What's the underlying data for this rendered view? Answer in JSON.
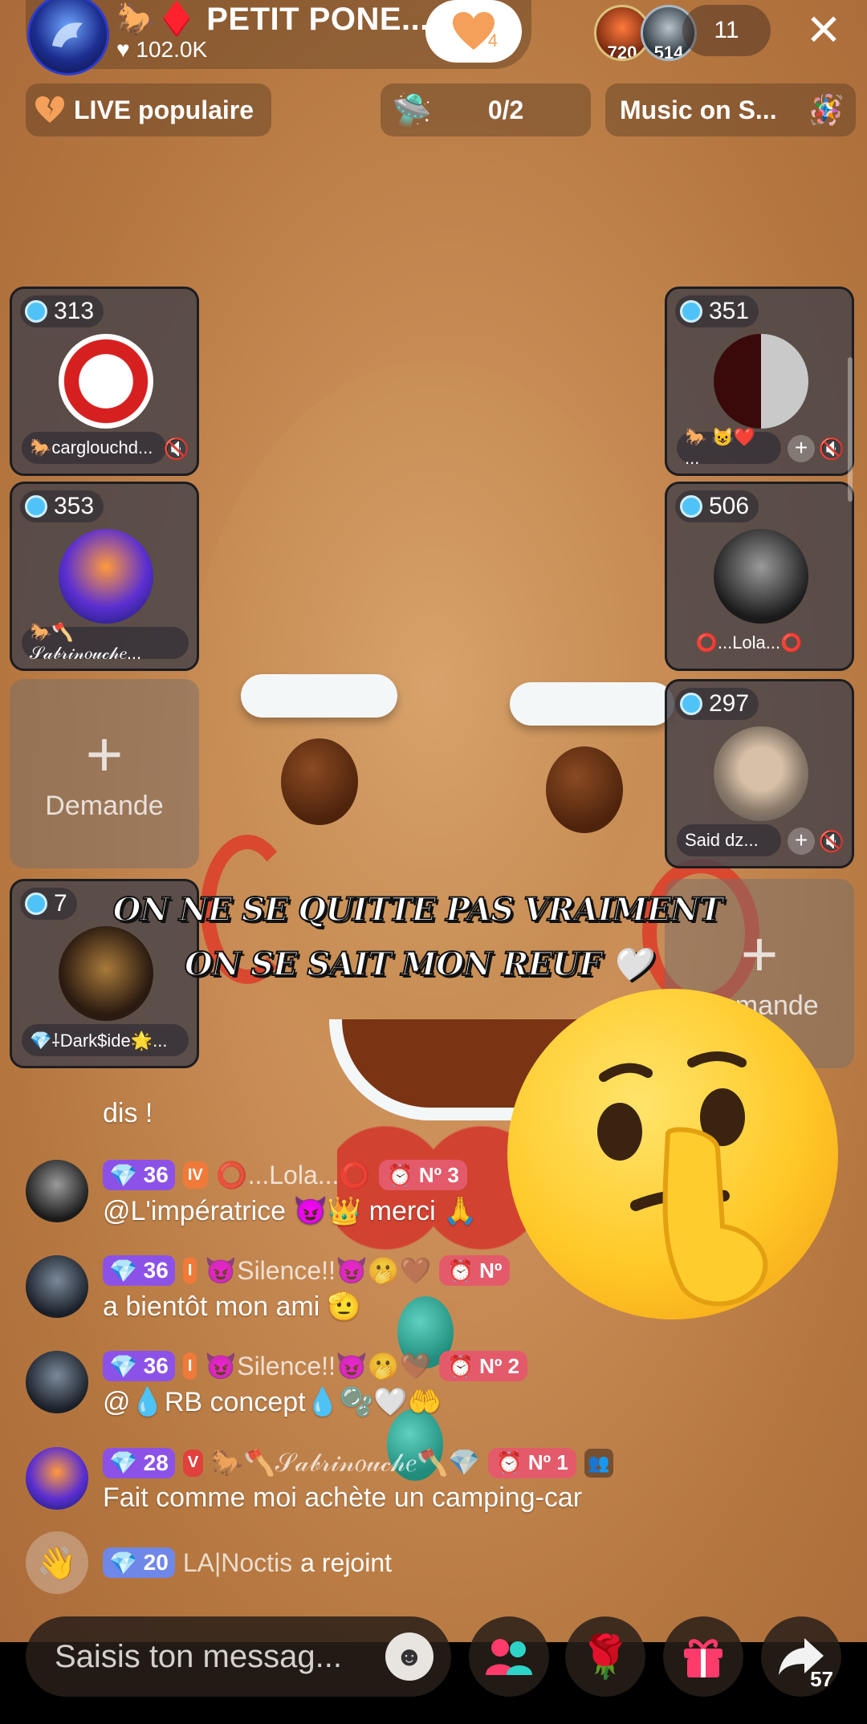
{
  "header": {
    "host_name": "🐎♦️ PETIT PONE...",
    "likes": "102.0K",
    "follow_badge": "4",
    "viewer_1_count": "720",
    "viewer_2_count": "514",
    "viewer_total": "11"
  },
  "chips": {
    "popular": "LIVE populaire",
    "progress": "0/2",
    "music": "Music on S..."
  },
  "tiles": {
    "left": [
      {
        "score": "313",
        "name": "🐎carglouchd..."
      },
      {
        "score": "353",
        "name": "🐎🪓𝒮𝒶𝒷𝓇𝒾𝓃𝑜𝓊𝒸𝒽𝑒..."
      },
      {
        "request_label": "Demande"
      },
      {
        "score": "7",
        "name": "💎⸸Dark$ide🌟..."
      }
    ],
    "right": [
      {
        "score": "351",
        "name": "🐎 😺❤️ ..."
      },
      {
        "score": "506",
        "name": "⭕...Lola...⭕"
      },
      {
        "score": "297",
        "name": "Said dz..."
      },
      {
        "request_label": "Demande"
      }
    ]
  },
  "overlay": {
    "line1": "ON NE SE QUITTE PAS VRAIMENT",
    "line2": "ON SE SAIT MON REUF 🤍"
  },
  "chat": [
    {
      "message": "dis !"
    },
    {
      "level": "36",
      "name": "⭕...Lola...⭕",
      "rank": "Nº 3",
      "message": "@L'impératrice 😈👑 merci 🙏"
    },
    {
      "level": "36",
      "name": "😈Silence!!😈🫢🤎",
      "rank": "Nº",
      "message": "a bientôt mon ami 🫡"
    },
    {
      "level": "36",
      "name": "😈Silence!!😈🫢🤎",
      "rank": "Nº 2",
      "message": "@💧RB concept💧🫧🤍🤲"
    },
    {
      "level": "28",
      "name": "🐎🪓𝒮𝒶𝒷𝓇𝒾𝓃𝑜𝓊𝒸𝒽𝑒🪓💎",
      "rank": "Nº 1",
      "message": "Fait comme moi achète un camping-car"
    },
    {
      "level": "20",
      "name": "LA|Noctis",
      "message": "a rejoint"
    }
  ],
  "bottom": {
    "placeholder": "Saisis ton messag...",
    "share_count": "57"
  },
  "colors": {
    "level_badge": "#8c52e8",
    "rank_badge": "#e35a6b",
    "gift_icon": "#ff3b6b",
    "people_icon": "#2dd4c8"
  }
}
